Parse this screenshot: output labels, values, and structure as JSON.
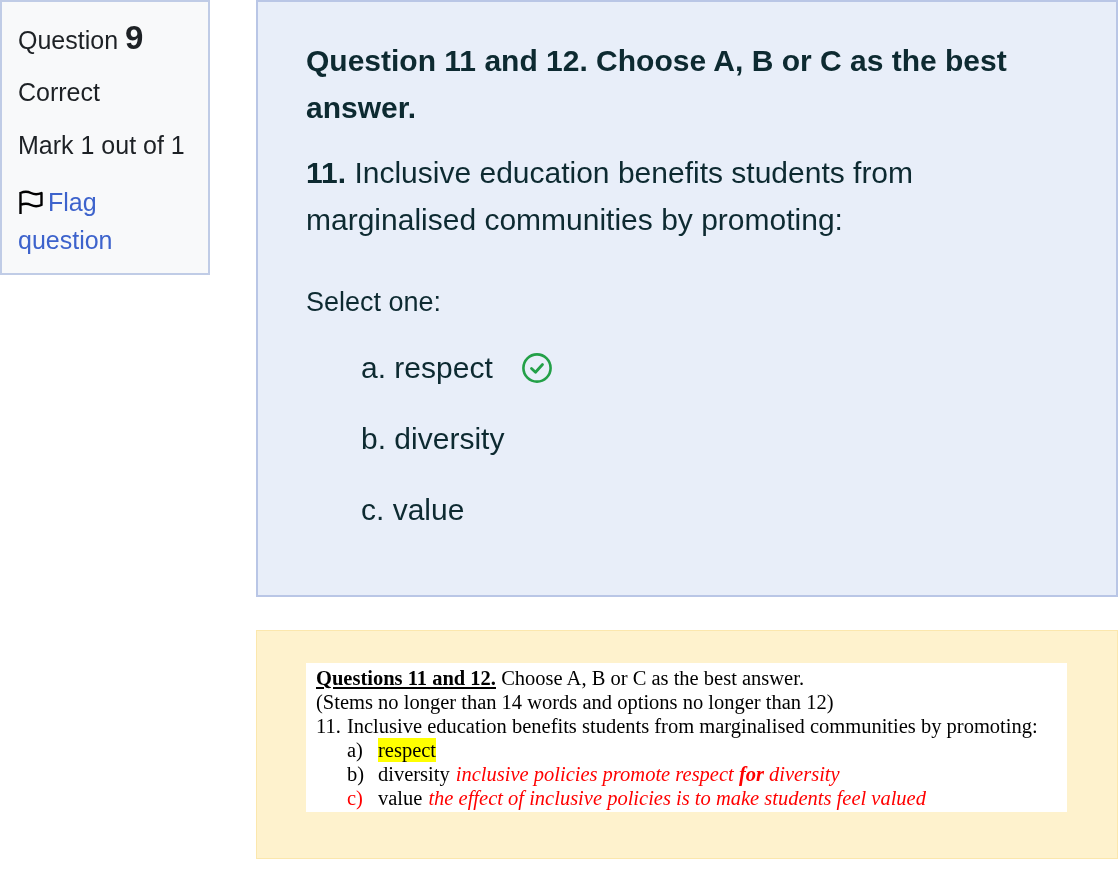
{
  "question_info": {
    "label": "Question",
    "number": "9",
    "status": "Correct",
    "mark": "Mark 1 out of 1",
    "flag_link": "Flag question",
    "flagged": false
  },
  "question": {
    "title": "Question 11 and 12. Choose A, B or C as the best answer.",
    "text": "**11.** Inclusive education benefits students from marginalised communities by promoting:",
    "prompt": "Select one:",
    "options": [
      {
        "label": "a. respect",
        "correct": true
      },
      {
        "label": "b. diversity",
        "correct": false
      },
      {
        "label": "c. value",
        "correct": false
      }
    ]
  },
  "feedback": {
    "document": {
      "heading": "Questions 11 and 12.",
      "instruction": "Choose A, B or C as the best answer.",
      "note": "(Stems no longer than 14 words and options no longer than 12)",
      "number": "11.",
      "stem": "Inclusive education benefits students from marginalised communities by promoting:",
      "options": [
        {
          "marker": "a)",
          "text": "respect",
          "highlighted": true,
          "color": "#000000"
        },
        {
          "marker": "b)",
          "text": "diversity",
          "highlighted": false,
          "color": "#000000",
          "comment": "inclusive policies promote respect **for** diversity"
        },
        {
          "marker": "c)",
          "text": "value",
          "highlighted": false,
          "color": "#ff0000",
          "comment": "the effect of inclusive policies is to make students feel valued"
        }
      ]
    }
  }
}
